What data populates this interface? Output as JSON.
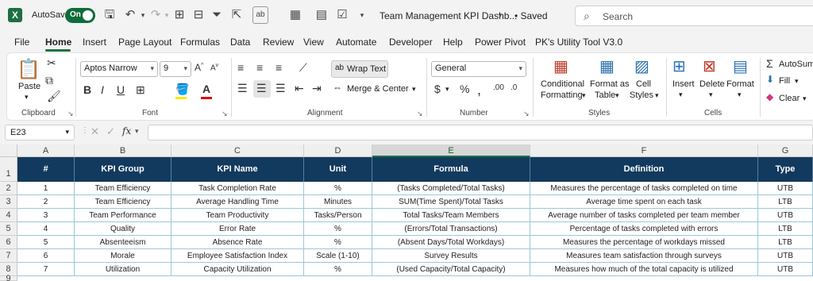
{
  "app": {
    "logo": "X",
    "autosave_label": "AutoSave",
    "autosave_state": "On",
    "doc_title": "Team Management KPI Dashb...",
    "saved_status": "• Saved",
    "search_placeholder": "Search",
    "brand_color": "#1e7145"
  },
  "tabs": [
    "File",
    "Home",
    "Insert",
    "Page Layout",
    "Formulas",
    "Data",
    "Review",
    "View",
    "Automate",
    "Developer",
    "Help",
    "Power Pivot",
    "PK's Utility Tool V3.0"
  ],
  "active_tab": "Home",
  "ribbon": {
    "clipboard": {
      "label": "Clipboard",
      "paste": "Paste"
    },
    "font": {
      "label": "Font",
      "name": "Aptos Narrow",
      "size": "9"
    },
    "alignment": {
      "label": "Alignment",
      "wrap_text": "Wrap Text",
      "merge_center": "Merge & Center"
    },
    "number": {
      "label": "Number",
      "format": "General"
    },
    "styles": {
      "label": "Styles",
      "conditional": "Conditional",
      "formatting": "Formatting",
      "format_as": "Format as",
      "table": "Table",
      "cell": "Cell",
      "cell_styles": "Styles"
    },
    "cells": {
      "label": "Cells",
      "insert": "Insert",
      "delete": "Delete",
      "format": "Format"
    },
    "editing": {
      "autosum": "AutoSum",
      "fill": "Fill",
      "clear": "Clear"
    }
  },
  "formula_bar": {
    "name_box": "E23",
    "fx": "fx",
    "value": ""
  },
  "sheet": {
    "columns": [
      "A",
      "B",
      "C",
      "D",
      "E",
      "F",
      "G"
    ],
    "selected_column": "E",
    "row_numbers": [
      "1",
      "2",
      "3",
      "4",
      "5",
      "6",
      "7",
      "8",
      "9"
    ],
    "header_color": "#123a5e",
    "headers": [
      "#",
      "KPI Group",
      "KPI Name",
      "Unit",
      "Formula",
      "Definition",
      "Type"
    ],
    "rows": [
      [
        "1",
        "Team Efficiency",
        "Task Completion Rate",
        "%",
        "(Tasks Completed/Total Tasks)",
        "Measures the percentage of tasks completed on time",
        "UTB"
      ],
      [
        "2",
        "Team Efficiency",
        "Average Handling Time",
        "Minutes",
        "SUM(Time Spent)/Total Tasks",
        "Average time spent on each task",
        "LTB"
      ],
      [
        "3",
        "Team Performance",
        "Team Productivity",
        "Tasks/Person",
        "Total Tasks/Team Members",
        "Average number of tasks completed per team member",
        "UTB"
      ],
      [
        "4",
        "Quality",
        "Error Rate",
        "%",
        "(Errors/Total Transactions)",
        "Percentage of tasks completed with errors",
        "LTB"
      ],
      [
        "5",
        "Absenteeism",
        "Absence Rate",
        "%",
        "(Absent Days/Total Workdays)",
        "Measures the percentage of workdays missed",
        "LTB"
      ],
      [
        "6",
        "Morale",
        "Employee Satisfaction Index",
        "Scale (1-10)",
        "Survey Results",
        "Measures team satisfaction through surveys",
        "UTB"
      ],
      [
        "7",
        "Utilization",
        "Capacity Utilization",
        "%",
        "(Used Capacity/Total Capacity)",
        "Measures how much of the total capacity is utilized",
        "UTB"
      ]
    ]
  }
}
